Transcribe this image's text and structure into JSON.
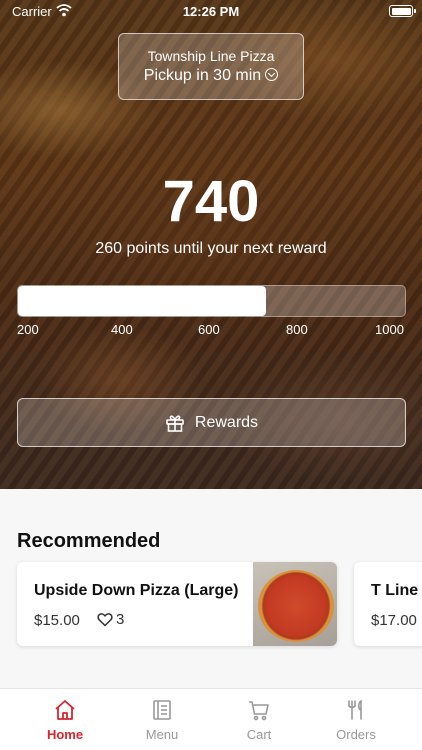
{
  "status_bar": {
    "carrier": "Carrier",
    "time": "12:26 PM"
  },
  "location": {
    "store_name": "Township Line Pizza",
    "pickup_text": "Pickup in 30 min"
  },
  "points": {
    "value": "740",
    "subtitle": "260 points until your next reward",
    "progress_fraction": 0.64,
    "scale_labels": [
      "200",
      "400",
      "600",
      "800",
      "1000"
    ]
  },
  "rewards_button": {
    "label": "Rewards",
    "icon": "gift-icon"
  },
  "recommended": {
    "title": "Recommended",
    "items": [
      {
        "name": "Upside Down Pizza (Large)",
        "price": "$15.00",
        "likes": "3"
      },
      {
        "name": "T Line",
        "price": "$17.00"
      }
    ]
  },
  "tab_bar": {
    "active_color": "#d7262e",
    "tabs": [
      {
        "label": "Home",
        "icon": "home-icon",
        "active": true
      },
      {
        "label": "Menu",
        "icon": "menu-icon",
        "active": false
      },
      {
        "label": "Cart",
        "icon": "cart-icon",
        "active": false
      },
      {
        "label": "Orders",
        "icon": "orders-icon",
        "active": false
      }
    ]
  }
}
